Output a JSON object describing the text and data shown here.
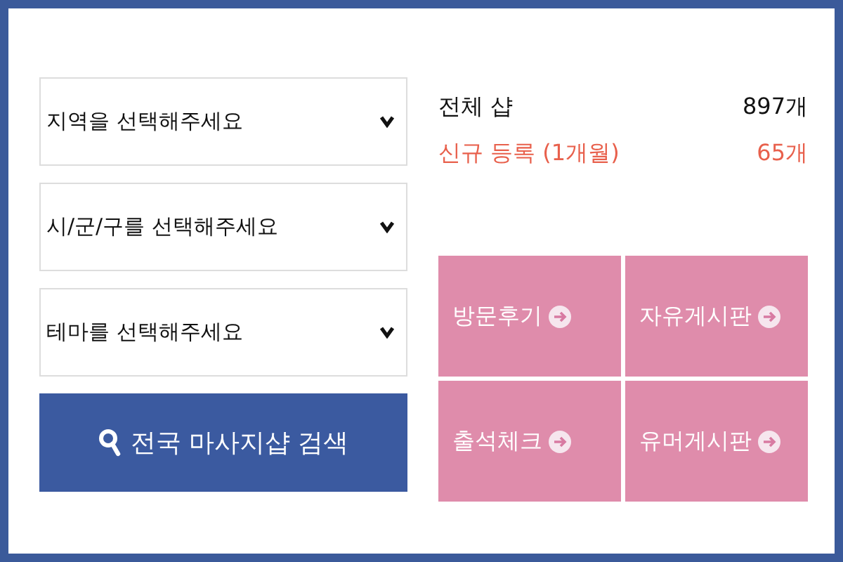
{
  "selects": [
    {
      "placeholder": "지역을 선택해주세요"
    },
    {
      "placeholder": "시/군/구를 선택해주세요"
    },
    {
      "placeholder": "테마를 선택해주세요"
    }
  ],
  "search_button": {
    "label": "전국 마사지샵 검색"
  },
  "stats": [
    {
      "kind": "total",
      "label": "전체 샵",
      "value": "897개"
    },
    {
      "kind": "new",
      "label": "신규 등록 (1개월)",
      "value": "65개"
    }
  ],
  "tiles": [
    {
      "label": "방문후기"
    },
    {
      "label": "자유게시판"
    },
    {
      "label": "출석체크"
    },
    {
      "label": "유머게시판"
    }
  ]
}
